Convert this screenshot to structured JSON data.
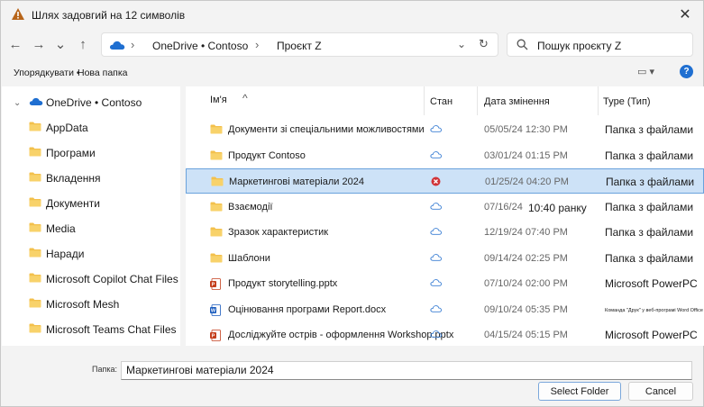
{
  "window": {
    "title": "Шлях задовгий на 12 символів",
    "close_glyph": "✕"
  },
  "navbar": {
    "back_glyph": "←",
    "forward_glyph": "→",
    "recent_glyph": "⌄",
    "up_glyph": "↑",
    "breadcrumb": [
      "OneDrive • Contoso",
      "Проєкт Z"
    ],
    "breadcrumb_sep": "›",
    "dropdown_glyph": "⌄",
    "refresh_glyph": "↻",
    "search_placeholder": "Пошук проєкту Z"
  },
  "commandbar": {
    "organize_label": "Упорядкувати •",
    "new_folder_label": "Нова папка",
    "view_glyph": "▭ ▾",
    "help_glyph": "?"
  },
  "sidebar": {
    "root": {
      "label": "OneDrive • Contoso",
      "icon": "cloud-icon"
    },
    "items": [
      {
        "label": "AppData",
        "icon": "folder-icon"
      },
      {
        "label": "Програми",
        "icon": "folder-icon"
      },
      {
        "label": "Вкладення",
        "icon": "folder-icon"
      },
      {
        "label": "Документи",
        "icon": "folder-icon"
      },
      {
        "label": "Media",
        "icon": "folder-icon"
      },
      {
        "label": "Наради",
        "icon": "folder-icon"
      },
      {
        "label": "Microsoft Copilot Chat Files",
        "icon": "folder-icon"
      },
      {
        "label": "Microsoft Mesh",
        "icon": "folder-icon"
      },
      {
        "label": "Microsoft Teams Chat Files",
        "icon": "folder-icon"
      }
    ]
  },
  "filelist": {
    "columns": {
      "name": "Ім'я",
      "sort_glyph": "^",
      "status": "Стан",
      "date": "Дата змінення",
      "type": "Type (Тип)"
    },
    "rows": [
      {
        "name": "Документи зі спеціальними можливостями",
        "icon": "folder-icon",
        "status": "cloud",
        "date": "05/05/24 12:30 PM",
        "date_extra": "",
        "type": "Папка з файлами",
        "selected": false
      },
      {
        "name": "Продукт Contoso",
        "icon": "folder-icon",
        "status": "cloud",
        "date": "03/01/24 01:15 PM",
        "date_extra": "",
        "type": "Папка з файлами",
        "selected": false
      },
      {
        "name": "Маркетингові матеріали 2024",
        "icon": "folder-icon",
        "status": "error",
        "date": "01/25/24 04:20 PM",
        "date_extra": "",
        "type": "Папка з файлами",
        "selected": true
      },
      {
        "name": "Взаємодії",
        "icon": "folder-icon",
        "status": "cloud",
        "date": "07/16/24",
        "date_extra": "10:40 ранку",
        "type": "Папка з файлами",
        "selected": false
      },
      {
        "name": "Зразок характеристик",
        "icon": "folder-icon",
        "status": "cloud",
        "date": "12/19/24 07:40 PM",
        "date_extra": "",
        "type": "Папка з файлами",
        "selected": false
      },
      {
        "name": "Шаблони",
        "icon": "folder-icon",
        "status": "cloud",
        "date": "09/14/24 02:25 PM",
        "date_extra": "",
        "type": "Папка з файлами",
        "selected": false
      },
      {
        "name": "Продукт storytelling.pptx",
        "icon": "pptx-icon",
        "status": "cloud",
        "date": "07/10/24 02:00 PM",
        "date_extra": "",
        "type": "Microsoft PowerPC",
        "selected": false
      },
      {
        "name": "Оцінювання програми Report.docx",
        "icon": "docx-icon",
        "status": "cloud",
        "date": "09/10/24 05:35 PM",
        "date_extra": "",
        "type": "Команда \"Друк\" у веб-програмі Word Office",
        "selected": false
      },
      {
        "name": "Досліджуйте острів - оформлення Workshop.pptx",
        "icon": "pptx-icon",
        "status": "cloud",
        "date": "04/15/24 05:15 PM",
        "date_extra": "",
        "type": "Microsoft PowerPC",
        "selected": false
      }
    ]
  },
  "footer": {
    "filename_label": "Папка:",
    "filename_value": "Маркетингові матеріали 2024",
    "select_label": "Select Folder",
    "cancel_label": "Cancel"
  },
  "colors": {
    "accent": "#1f6fd1",
    "folder": "#f3c04c",
    "selection": "#cde2f7",
    "error": "#d13438",
    "warning": "#b7651a"
  }
}
